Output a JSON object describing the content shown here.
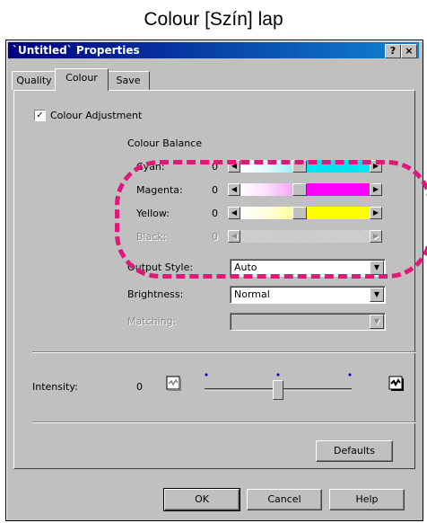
{
  "caption": "Colour [Szín] lap",
  "window": {
    "title": "`Untitled` Properties",
    "help_btn": "?",
    "close_btn": "×"
  },
  "tabs": [
    {
      "label": "Quality",
      "active": false
    },
    {
      "label": "Colour",
      "active": true
    },
    {
      "label": "Save",
      "active": false
    }
  ],
  "colour_adjustment": {
    "label": "Colour Adjustment",
    "checked": true,
    "mark": "✓"
  },
  "colour_balance": {
    "heading": "Colour Balance",
    "channels": [
      {
        "label": "Cyan:",
        "value": "0",
        "color": "#00e6f0",
        "enabled": true
      },
      {
        "label": "Magenta:",
        "value": "0",
        "color": "#ff00ff",
        "enabled": true
      },
      {
        "label": "Yellow:",
        "value": "0",
        "color": "#ffff00",
        "enabled": true
      },
      {
        "label": "Black:",
        "value": "0",
        "color": "#000000",
        "enabled": false
      }
    ]
  },
  "output_style": {
    "label": "Output Style:",
    "value": "Auto"
  },
  "brightness": {
    "label": "Brightness:",
    "value": "Normal"
  },
  "matching": {
    "label": "Matching:",
    "value": ""
  },
  "intensity": {
    "label": "Intensity:",
    "value": "0",
    "level": 0.5
  },
  "buttons": {
    "defaults": "Defaults",
    "ok": "OK",
    "cancel": "Cancel",
    "help": "Help"
  },
  "arrows": {
    "left": "◀",
    "right": "▶",
    "down": "▼"
  },
  "accent": "#e0187a"
}
